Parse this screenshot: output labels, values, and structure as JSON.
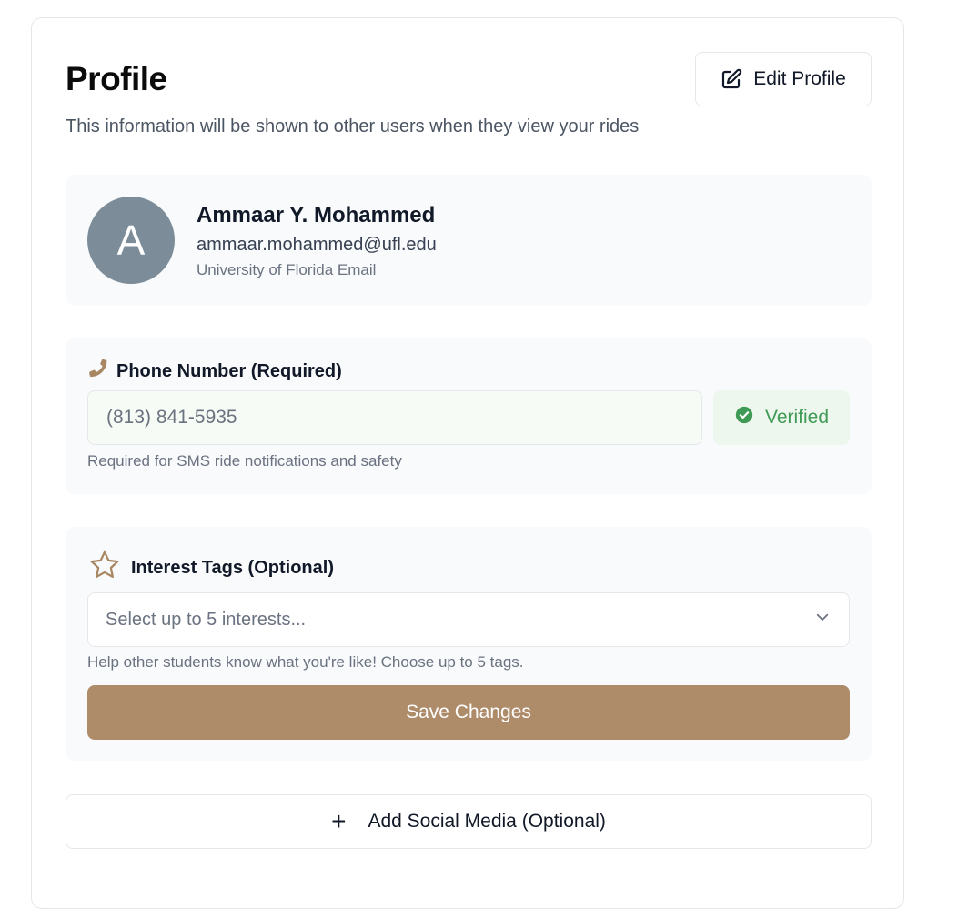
{
  "profile": {
    "title": "Profile",
    "edit_label": "Edit Profile",
    "subtitle": "This information will be shown to other users when they view your rides"
  },
  "user": {
    "avatar_initial": "A",
    "name": "Ammaar Y. Mohammed",
    "email": "ammaar.mohammed@ufl.edu",
    "email_note": "University of Florida Email"
  },
  "phone": {
    "label": "Phone Number (Required)",
    "value": "(813) 841-5935",
    "status": "Verified",
    "helper": "Required for SMS ride notifications and safety",
    "icon": "phone-icon"
  },
  "interests": {
    "label": "Interest Tags (Optional)",
    "placeholder": "Select up to 5 interests...",
    "helper": "Help other students know what you're like! Choose up to 5 tags.",
    "icon": "star-icon"
  },
  "actions": {
    "save_label": "Save Changes",
    "social_label": "Add Social Media (Optional)",
    "social_icon": "+"
  },
  "colors": {
    "accent": "#ae8c6a",
    "avatar_bg": "#7c8d99",
    "verified": "#3f9a55",
    "section_bg": "#f8fafc"
  }
}
